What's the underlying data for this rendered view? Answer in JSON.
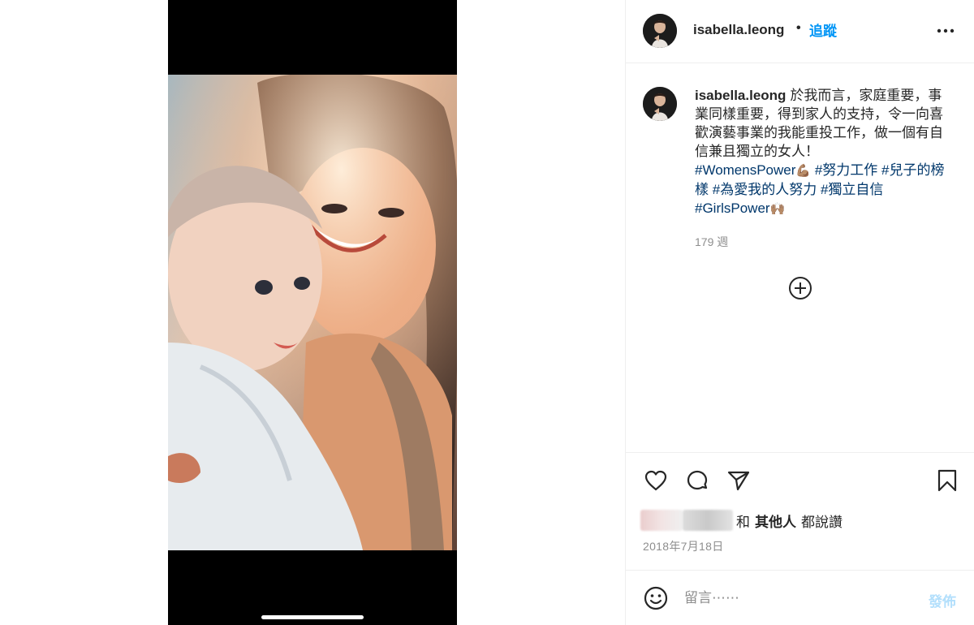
{
  "post": {
    "username": "isabella.leong",
    "follow_label": "追蹤",
    "separator": "•",
    "caption": {
      "text": "於我而言，家庭重要，事業同樣重要，得到家人的支持，令一向喜歡演藝事業的我能重投工作，做一個有自信兼且獨立的女人！",
      "hashtags": [
        "#WomensPower",
        "#努力工作",
        "#兒子的榜樣",
        "#為愛我的人努力",
        "#獨立自信",
        "#GirlsPower"
      ],
      "emoji_1": "💪🏽",
      "emoji_2": "🙌🏽"
    },
    "age": "179 週",
    "likes": {
      "and_label": "和",
      "others_label": "其他人",
      "liked_label": "都說讚"
    },
    "date": "2018年7月18日",
    "comment": {
      "placeholder": "留言⋯⋯",
      "post_label": "發佈"
    }
  },
  "icons": {
    "more": "more-horizontal-icon",
    "load_more": "plus-circle-icon",
    "like": "heart-icon",
    "comment": "comment-bubble-icon",
    "share": "paper-plane-icon",
    "save": "bookmark-icon",
    "emoji": "smiley-icon"
  },
  "colors": {
    "accent": "#0095f6",
    "hashtag": "#00376b",
    "muted": "#8e8e8e",
    "post_disabled": "#b2dffc",
    "border": "#efefef"
  }
}
